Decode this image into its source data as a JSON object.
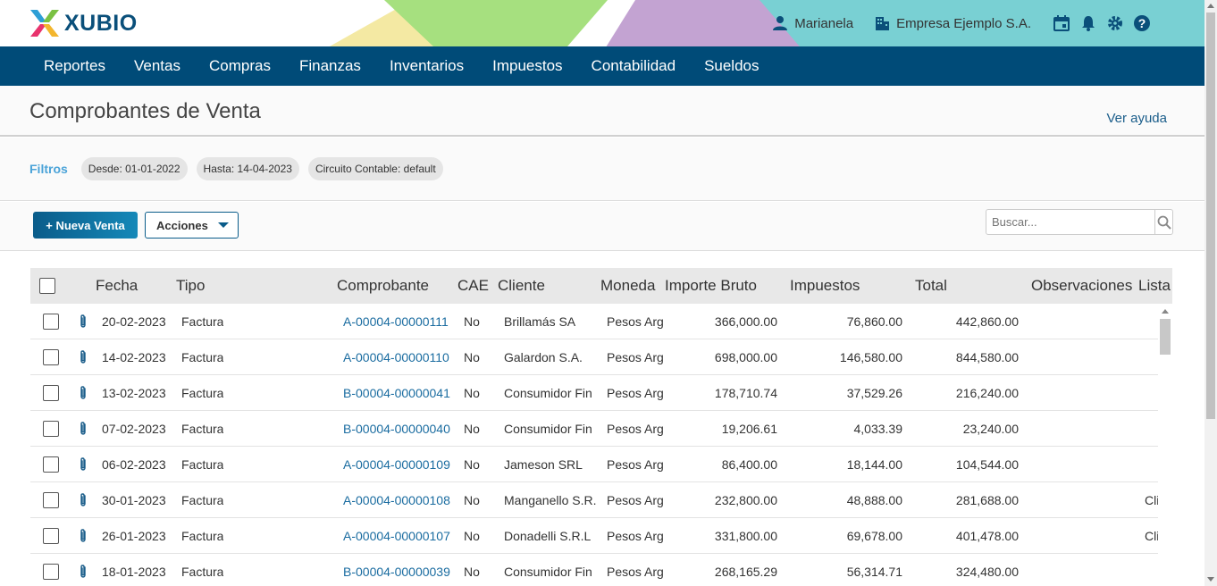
{
  "header": {
    "logo_text": "XUBIO",
    "user_name": "Marianela",
    "company_name": "Empresa Ejemplo S.A."
  },
  "nav": {
    "items": [
      "Reportes",
      "Ventas",
      "Compras",
      "Finanzas",
      "Inventarios",
      "Impuestos",
      "Contabilidad",
      "Sueldos"
    ]
  },
  "page": {
    "title": "Comprobantes de Venta",
    "help": "Ver ayuda"
  },
  "filters": {
    "label": "Filtros",
    "chips": [
      "Desde:  01-01-2022",
      "Hasta:  14-04-2023",
      "Circuito Contable:  default"
    ]
  },
  "toolbar": {
    "new_label": "+ Nueva Venta",
    "actions_label": "Acciones",
    "search_placeholder": "Buscar..."
  },
  "table": {
    "headers": [
      "Fecha",
      "Tipo",
      "Comprobante",
      "CAE",
      "Cliente",
      "Moneda",
      "Importe Bruto",
      "Impuestos",
      "Total",
      "Observaciones",
      "Lista"
    ],
    "rows": [
      {
        "fecha": "20-02-2023",
        "tipo": "Factura",
        "comp": "A-00004-00000111",
        "cae": "No",
        "cliente": "Brillamás SA",
        "moneda": "Pesos Arg",
        "bruto": "366,000.00",
        "imp": "76,860.00",
        "total": "442,860.00",
        "lista": ""
      },
      {
        "fecha": "14-02-2023",
        "tipo": "Factura",
        "comp": "A-00004-00000110",
        "cae": "No",
        "cliente": "Galardon S.A.",
        "moneda": "Pesos Arg",
        "bruto": "698,000.00",
        "imp": "146,580.00",
        "total": "844,580.00",
        "lista": ""
      },
      {
        "fecha": "13-02-2023",
        "tipo": "Factura",
        "comp": "B-00004-00000041",
        "cae": "No",
        "cliente": "Consumidor Fin",
        "moneda": "Pesos Arg",
        "bruto": "178,710.74",
        "imp": "37,529.26",
        "total": "216,240.00",
        "lista": ""
      },
      {
        "fecha": "07-02-2023",
        "tipo": "Factura",
        "comp": "B-00004-00000040",
        "cae": "No",
        "cliente": "Consumidor Fin",
        "moneda": "Pesos Arg",
        "bruto": "19,206.61",
        "imp": "4,033.39",
        "total": "23,240.00",
        "lista": ""
      },
      {
        "fecha": "06-02-2023",
        "tipo": "Factura",
        "comp": "A-00004-00000109",
        "cae": "No",
        "cliente": "Jameson SRL",
        "moneda": "Pesos Arg",
        "bruto": "86,400.00",
        "imp": "18,144.00",
        "total": "104,544.00",
        "lista": ""
      },
      {
        "fecha": "30-01-2023",
        "tipo": "Factura",
        "comp": "A-00004-00000108",
        "cae": "No",
        "cliente": "Manganello S.R.",
        "moneda": "Pesos Arg",
        "bruto": "232,800.00",
        "imp": "48,888.00",
        "total": "281,688.00",
        "lista": "Cli"
      },
      {
        "fecha": "26-01-2023",
        "tipo": "Factura",
        "comp": "A-00004-00000107",
        "cae": "No",
        "cliente": "Donadelli S.R.L",
        "moneda": "Pesos Arg",
        "bruto": "331,800.00",
        "imp": "69,678.00",
        "total": "401,478.00",
        "lista": "Cli"
      },
      {
        "fecha": "18-01-2023",
        "tipo": "Factura",
        "comp": "B-00004-00000039",
        "cae": "No",
        "cliente": "Consumidor Fin",
        "moneda": "Pesos Arg",
        "bruto": "268,165.29",
        "imp": "56,314.71",
        "total": "324,480.00",
        "lista": ""
      }
    ]
  },
  "colors": {
    "nav_bg": "#004b78",
    "link": "#1a6ca0",
    "filter_label": "#4aa3d8"
  }
}
